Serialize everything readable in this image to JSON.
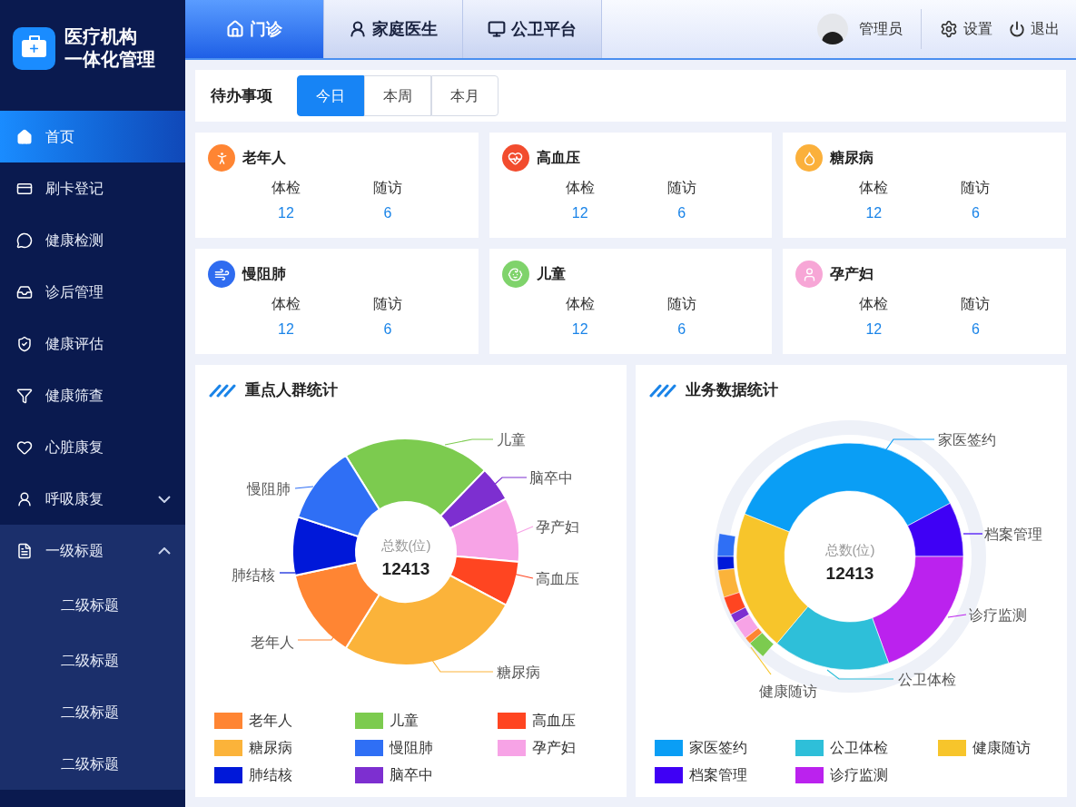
{
  "brand": {
    "line1": "医疗机构",
    "line2": "一体化管理"
  },
  "sidebar": {
    "items": [
      {
        "label": "首页",
        "selected": true
      },
      {
        "label": "刷卡登记",
        "selected": false
      },
      {
        "label": "健康检测",
        "selected": false
      },
      {
        "label": "诊后管理",
        "selected": false
      },
      {
        "label": "健康评估",
        "selected": false
      },
      {
        "label": "健康筛查",
        "selected": false
      },
      {
        "label": "心脏康复",
        "selected": false
      },
      {
        "label": "呼吸康复",
        "selected": false,
        "expanded": false
      },
      {
        "label": "一级标题",
        "selected": false,
        "expanded": true,
        "children": [
          {
            "label": "二级标题"
          },
          {
            "label": "二级标题"
          },
          {
            "label": "二级标题"
          },
          {
            "label": "二级标题"
          }
        ]
      }
    ]
  },
  "header": {
    "tabs": [
      {
        "label": "门诊",
        "selected": true
      },
      {
        "label": "家庭医生",
        "selected": false
      },
      {
        "label": "公卫平台",
        "selected": false
      }
    ],
    "user": "管理员",
    "settings": "设置",
    "logout": "退出"
  },
  "todo": {
    "title": "待办事项",
    "periods": [
      {
        "label": "今日",
        "selected": true
      },
      {
        "label": "本周",
        "selected": false
      },
      {
        "label": "本月",
        "selected": false
      }
    ]
  },
  "groups": [
    {
      "title": "老年人",
      "color": "#ff8533",
      "stats": [
        {
          "label": "体检",
          "value": "12"
        },
        {
          "label": "随访",
          "value": "6"
        }
      ]
    },
    {
      "title": "高血压",
      "color": "#f24c2e",
      "stats": [
        {
          "label": "体检",
          "value": "12"
        },
        {
          "label": "随访",
          "value": "6"
        }
      ]
    },
    {
      "title": "糖尿病",
      "color": "#fbb03b",
      "stats": [
        {
          "label": "体检",
          "value": "12"
        },
        {
          "label": "随访",
          "value": "6"
        }
      ]
    },
    {
      "title": "慢阻肺",
      "color": "#2f6cf0",
      "stats": [
        {
          "label": "体检",
          "value": "12"
        },
        {
          "label": "随访",
          "value": "6"
        }
      ]
    },
    {
      "title": "儿童",
      "color": "#7fd36b",
      "stats": [
        {
          "label": "体检",
          "value": "12"
        },
        {
          "label": "随访",
          "value": "6"
        }
      ]
    },
    {
      "title": "孕产妇",
      "color": "#f7a6d6",
      "stats": [
        {
          "label": "体检",
          "value": "12"
        },
        {
          "label": "随访",
          "value": "6"
        }
      ]
    }
  ],
  "charts": [
    {
      "title": "重点人群统计",
      "center_label": "总数(位)",
      "total": "12413",
      "callouts": [
        "儿童",
        "脑卒中",
        "孕产妇",
        "高血压",
        "糖尿病",
        "老年人",
        "肺结核",
        "慢阻肺"
      ],
      "legend": [
        {
          "label": "老年人",
          "color": "#ff8533"
        },
        {
          "label": "儿童",
          "color": "#7ccb4f"
        },
        {
          "label": "高血压",
          "color": "#ff4521"
        },
        {
          "label": "糖尿病",
          "color": "#fbb33a"
        },
        {
          "label": "慢阻肺",
          "color": "#2f6ff5"
        },
        {
          "label": "孕产妇",
          "color": "#f7a3e6"
        },
        {
          "label": "肺结核",
          "color": "#0018d9"
        },
        {
          "label": "脑卒中",
          "color": "#7d2fd0"
        }
      ]
    },
    {
      "title": "业务数据统计",
      "center_label": "总数(位)",
      "total": "12413",
      "callouts": [
        "家医签约",
        "档案管理",
        "诊疗监测",
        "公卫体检",
        "健康随访"
      ],
      "legend": [
        {
          "label": "家医签约",
          "color": "#0a9ef5"
        },
        {
          "label": "公卫体检",
          "color": "#2ebfd9"
        },
        {
          "label": "健康随访",
          "color": "#f7c52b"
        },
        {
          "label": "档案管理",
          "color": "#3f00f5"
        },
        {
          "label": "诊疗监测",
          "color": "#bb22ee"
        }
      ]
    }
  ]
}
